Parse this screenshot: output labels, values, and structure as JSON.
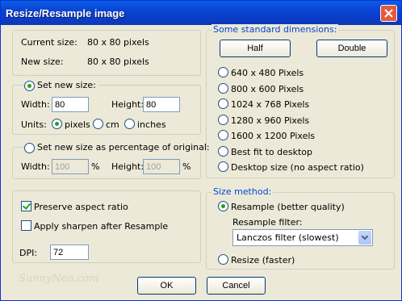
{
  "window": {
    "title": "Resize/Resample image"
  },
  "size_info": {
    "current_label": "Current size:",
    "current_value": "80  x  80  pixels",
    "new_label": "New size:",
    "new_value": "80  x  80  pixels"
  },
  "set_size": {
    "label": "Set new size:",
    "width_label": "Width:",
    "width_value": "80",
    "height_label": "Height:",
    "height_value": "80",
    "units_label": "Units:",
    "units": [
      "pixels",
      "cm",
      "inches"
    ],
    "selected_unit": "pixels"
  },
  "percentage": {
    "label": "Set new size as percentage of original:",
    "width_label": "Width:",
    "width_value": "100",
    "height_label": "Height:",
    "height_value": "100",
    "unit": "%"
  },
  "options": {
    "preserve_label": "Preserve aspect ratio",
    "preserve_checked": true,
    "sharpen_label": "Apply sharpen after Resample",
    "sharpen_checked": false,
    "dpi_label": "DPI:",
    "dpi_value": "72"
  },
  "standard": {
    "title": "Some standard dimensions:",
    "half": "Half",
    "double": "Double",
    "items": [
      "640 x 480 Pixels",
      "800 x 600 Pixels",
      "1024 x 768 Pixels",
      "1280 x 960 Pixels",
      "1600 x 1200 Pixels",
      "Best fit to desktop",
      "Desktop size (no aspect ratio)"
    ]
  },
  "method": {
    "title": "Size method:",
    "resample_label": "Resample (better quality)",
    "filter_label": "Resample filter:",
    "filter_value": "Lanczos filter (slowest)",
    "resize_label": "Resize (faster)"
  },
  "buttons": {
    "ok": "OK",
    "cancel": "Cancel"
  },
  "watermark": "SunnyNeo.com",
  "colors": {
    "titlebar": "#0a5de6",
    "group_title": "#0046d5",
    "background": "#ece9d8"
  }
}
